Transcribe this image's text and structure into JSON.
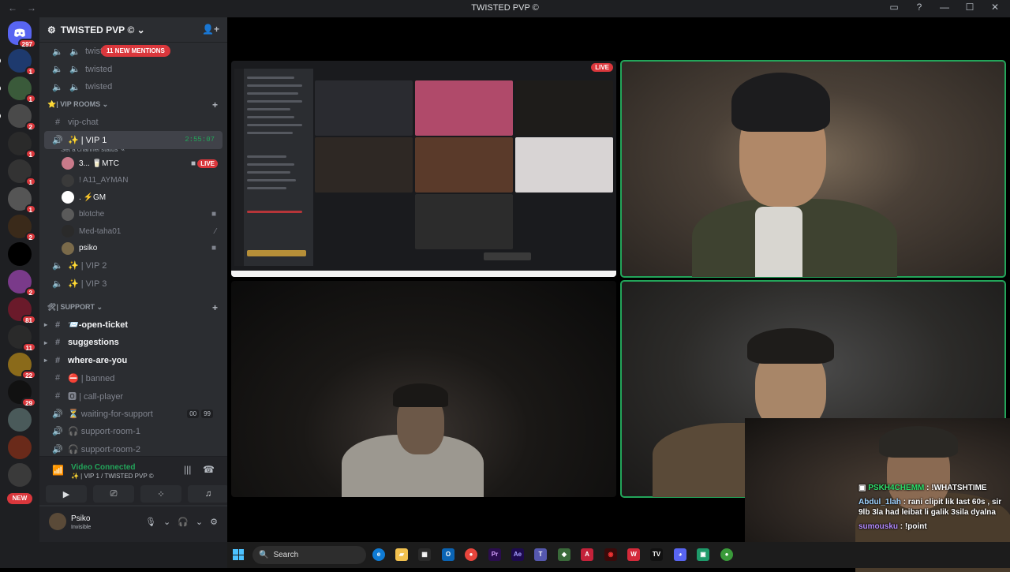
{
  "window": {
    "title": "TWISTED PVP",
    "nav_back": "←",
    "nav_forward": "→",
    "controls": [
      "▭",
      "?",
      "—",
      "☐",
      "✕"
    ]
  },
  "guilds": {
    "items": [
      {
        "name": "direct-messages",
        "badge": "297",
        "color": "#5865f2"
      },
      {
        "name": "server-1",
        "badge": "1",
        "color": "#1e3a6e"
      },
      {
        "name": "server-2",
        "badge": "1",
        "color": "#3a5a3a"
      },
      {
        "name": "server-3",
        "badge": "2",
        "color": "#4a4a4a"
      },
      {
        "name": "server-4",
        "badge": "1",
        "color": "#2a2a2a"
      },
      {
        "name": "server-5",
        "badge": "1",
        "color": "#333333"
      },
      {
        "name": "server-6",
        "badge": "1",
        "color": "#555555"
      },
      {
        "name": "server-7",
        "badge": "2",
        "color": "#3a2a1a"
      },
      {
        "name": "server-8",
        "badge": "",
        "color": "#000000"
      },
      {
        "name": "server-9",
        "badge": "2",
        "color": "#7a3a8a"
      },
      {
        "name": "server-10",
        "badge": "81",
        "color": "#6a1a2a"
      },
      {
        "name": "server-11",
        "badge": "11",
        "color": "#2a2a2a"
      },
      {
        "name": "server-12",
        "badge": "22",
        "color": "#8a6a1a"
      },
      {
        "name": "server-13",
        "badge": "29",
        "color": "#111111"
      },
      {
        "name": "server-14",
        "badge": "",
        "color": "#4a5a5a"
      },
      {
        "name": "server-15",
        "badge": "",
        "color": "#6a2a1a"
      },
      {
        "name": "server-16",
        "badge": "",
        "color": "#3a3a3a"
      }
    ],
    "new_label": "NEW"
  },
  "server": {
    "name": "TWISTED PVP",
    "mentions_label": "11 NEW MENTIONS",
    "top_channels": [
      "twisted",
      "twisted",
      "twisted"
    ],
    "vip_category": "⭐| VIP ROOMS",
    "vip_chat": "vip-chat",
    "vip1": {
      "name": "✨ | VIP 1",
      "time": "2:55:07",
      "status": "Set a channel status"
    },
    "vip_members": [
      {
        "name": "3... 🥛MTC",
        "live": "LIVE",
        "bold": true
      },
      {
        "name": "! A11_AYMAN",
        "bold": false
      },
      {
        "name": ". ⚡GM",
        "bold": true
      },
      {
        "name": "blotche",
        "bold": false
      },
      {
        "name": "Med-taha01",
        "bold": false
      },
      {
        "name": "psiko",
        "bold": true
      }
    ],
    "vip2": "✨ | VIP 2",
    "vip3": "✨ | VIP 3",
    "support_category": "🛠| SUPPORT",
    "support_channels": [
      {
        "icon": "#",
        "name": "📨-open-ticket",
        "unread": true
      },
      {
        "icon": "#",
        "name": "suggestions",
        "unread": true
      },
      {
        "icon": "#",
        "name": "where-are-you",
        "unread": true
      },
      {
        "icon": "#",
        "name": "⛔ | banned",
        "unread": false
      },
      {
        "icon": "#",
        "name": "🅾 | call-player",
        "unread": false
      },
      {
        "icon": "🔊",
        "name": "⏳ waiting-for-support",
        "unread": false,
        "tags": [
          "00",
          "99"
        ]
      },
      {
        "icon": "🔊",
        "name": "🎧 support-room-1",
        "unread": false
      },
      {
        "icon": "🔊",
        "name": "🎧 support-room-2",
        "unread": false
      }
    ]
  },
  "voice": {
    "title": "Video Connected",
    "subtitle": "✨ | VIP 1 / TWISTED PVP"
  },
  "user": {
    "name": "Psiko",
    "status": "Invisible"
  },
  "stage": {
    "live_label": "LIVE"
  },
  "chat": [
    {
      "user": "PSKH4CHEMM",
      "message": ": !WHATSHTIME"
    },
    {
      "user": "Abdul_1lah",
      "message": ": rani clipit lik last 60s , sir 9lb 3la had leibat li galik 3sila dyalna"
    },
    {
      "user": "sumousku",
      "message": ": !point"
    }
  ],
  "taskbar": {
    "search_label": "Search"
  },
  "colors": {
    "accent": "#5865f2",
    "live": "#da373c",
    "connected": "#23a55a",
    "sidebar": "#2b2d31",
    "rail": "#1e1f22"
  }
}
